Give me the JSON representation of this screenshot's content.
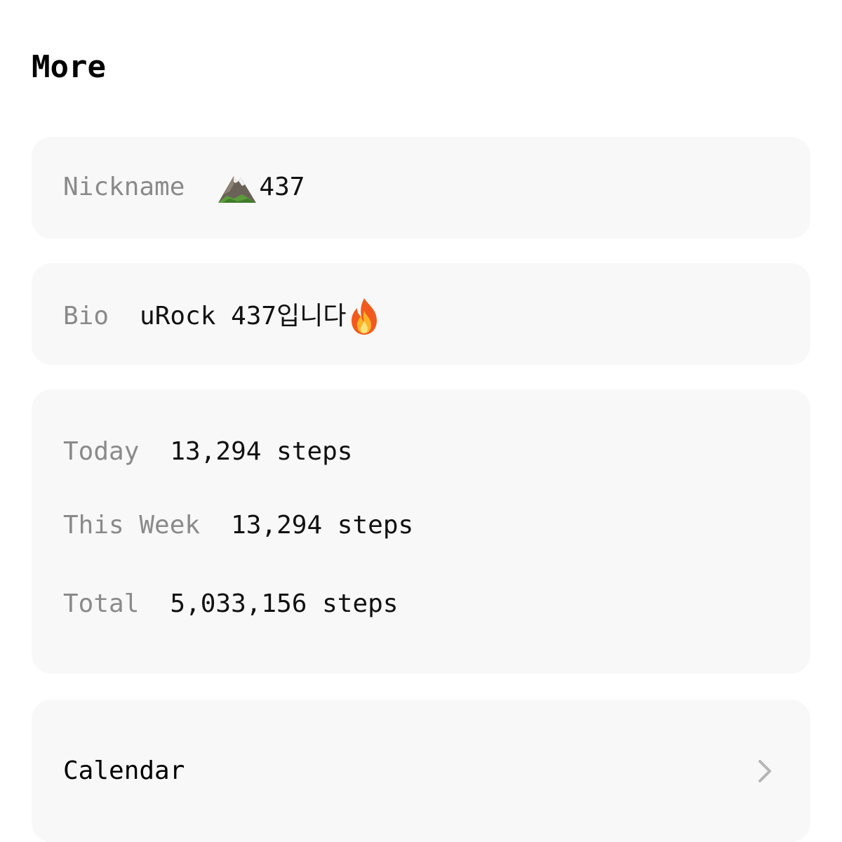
{
  "header": {
    "title": "More"
  },
  "profile": {
    "nickname_label": "Nickname",
    "nickname_value": "437",
    "nickname_icon": "mountain-icon",
    "bio_label": "Bio",
    "bio_value": "uRock 437입니다",
    "bio_icon": "fire-icon"
  },
  "steps": {
    "today_label": "Today",
    "today_value": "13,294 steps",
    "week_label": "This Week",
    "week_value": "13,294 steps",
    "total_label": "Total",
    "total_value": "5,033,156 steps"
  },
  "menu": {
    "calendar_label": "Calendar",
    "calendar_icon": "chevron-right-icon"
  },
  "colors": {
    "card_background": "#f8f8f8",
    "label_gray": "#8a8a8a",
    "text_dark": "#111111",
    "chevron_gray": "#b5b5b5"
  }
}
